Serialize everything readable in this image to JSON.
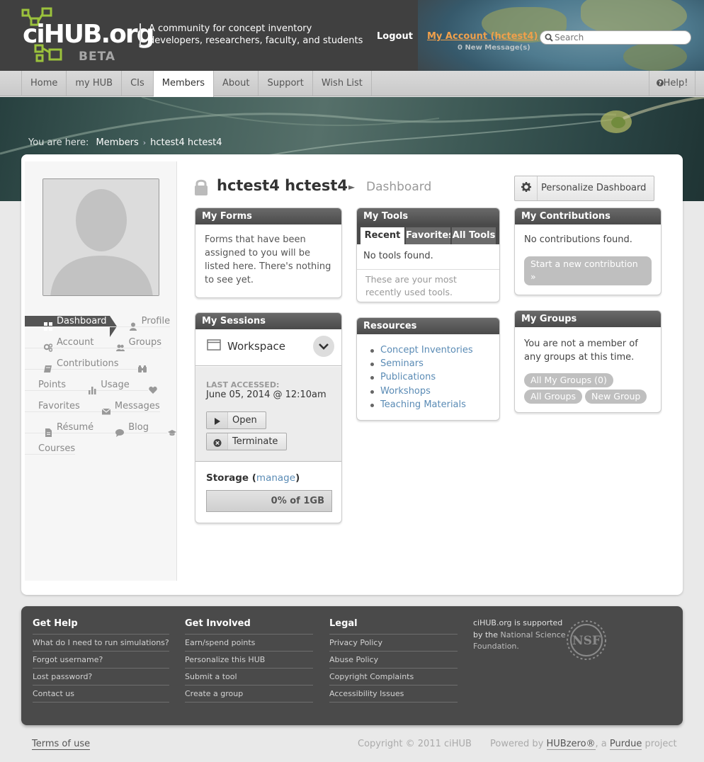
{
  "header": {
    "logo_text": "ciHUB.org",
    "logo_beta": "BETA",
    "tagline": "A community for concept inventory developers, researchers, faculty, and students",
    "logout": "Logout",
    "my_account": "My Account (hctest4)",
    "new_messages": "0 New Message(s)",
    "search_placeholder": "Search"
  },
  "nav": {
    "tabs": [
      "Home",
      "my HUB",
      "CIs",
      "Members",
      "About",
      "Support",
      "Wish List"
    ],
    "active": "Members",
    "help": "Help!"
  },
  "breadcrumb": {
    "prefix": "You are here:",
    "items": [
      "Members",
      "hctest4 hctest4"
    ]
  },
  "sidebar": {
    "items": [
      {
        "label": "Dashboard",
        "icon": "dashboard-icon"
      },
      {
        "label": "Profile",
        "icon": "user-icon"
      },
      {
        "label": "Account",
        "icon": "gears-icon"
      },
      {
        "label": "Groups",
        "icon": "users-icon"
      },
      {
        "label": "Contributions",
        "icon": "book-icon"
      },
      {
        "label": "Points",
        "icon": "binoculars-icon"
      },
      {
        "label": "Usage",
        "icon": "bar-chart-icon"
      },
      {
        "label": "Favorites",
        "icon": "heart-icon"
      },
      {
        "label": "Messages",
        "icon": "envelope-icon"
      },
      {
        "label": "Résumé",
        "icon": "file-icon"
      },
      {
        "label": "Blog",
        "icon": "comment-icon"
      },
      {
        "label": "Courses",
        "icon": "graduation-cap-icon"
      }
    ],
    "active": "Dashboard"
  },
  "page": {
    "title": "hctest4 hctest4",
    "subtitle": "Dashboard",
    "personalize_button": "Personalize Dashboard"
  },
  "modules": {
    "my_forms": {
      "title": "My Forms",
      "text": "Forms that have been assigned to you will be listed here. There's nothing to see yet."
    },
    "my_tools": {
      "title": "My Tools",
      "tabs": [
        "Recent",
        "Favorites",
        "All Tools"
      ],
      "empty": "No tools found.",
      "note": "These are your most recently used tools."
    },
    "my_contributions": {
      "title": "My Contributions",
      "empty": "No contributions found.",
      "start_button": "Start a new contribution »"
    },
    "my_sessions": {
      "title": "My Sessions",
      "session_name": "Workspace",
      "last_accessed_label": "LAST ACCESSED:",
      "last_accessed": "June 05, 2014 @ 12:10am",
      "open": "Open",
      "terminate": "Terminate",
      "storage_label": "Storage",
      "storage_link": "manage",
      "storage_value": "0% of 1GB",
      "storage_fraction": 0.0
    },
    "resources": {
      "title": "Resources",
      "items": [
        "Concept Inventories",
        "Seminars",
        "Publications",
        "Workshops",
        "Teaching Materials"
      ]
    },
    "my_groups": {
      "title": "My Groups",
      "text": "You are not a member of any groups at this time.",
      "buttons": [
        "All My Groups (0)",
        "All Groups",
        "New Group"
      ]
    }
  },
  "footer": {
    "columns": [
      {
        "title": "Get Help",
        "links": [
          "What do I need to run simulations?",
          "Forgot username?",
          "Lost password?",
          "Contact us"
        ]
      },
      {
        "title": "Get Involved",
        "links": [
          "Earn/spend points",
          "Personalize this HUB",
          "Submit a tool",
          "Create a group"
        ]
      },
      {
        "title": "Legal",
        "links": [
          "Privacy Policy",
          "Abuse Policy",
          "Copyright Complaints",
          "Accessibility Issues"
        ]
      }
    ],
    "support_prefix": "ciHUB.org is supported by the",
    "support_org": "National Science Foundation.",
    "nsf_logo_text": "NSF"
  },
  "bottom": {
    "terms": "Terms of use",
    "copyright": "Copyright © 2011 ciHUB",
    "powered_prefix": "Powered by",
    "powered_hubzero": "HUBzero®",
    "powered_mid": ", a",
    "powered_purdue": "Purdue",
    "powered_suffix": "project"
  },
  "colors": {
    "header_bg": "#404040",
    "account_link": "#f0a04b",
    "link_blue": "#5a8bb5",
    "module_head": "#555555"
  }
}
